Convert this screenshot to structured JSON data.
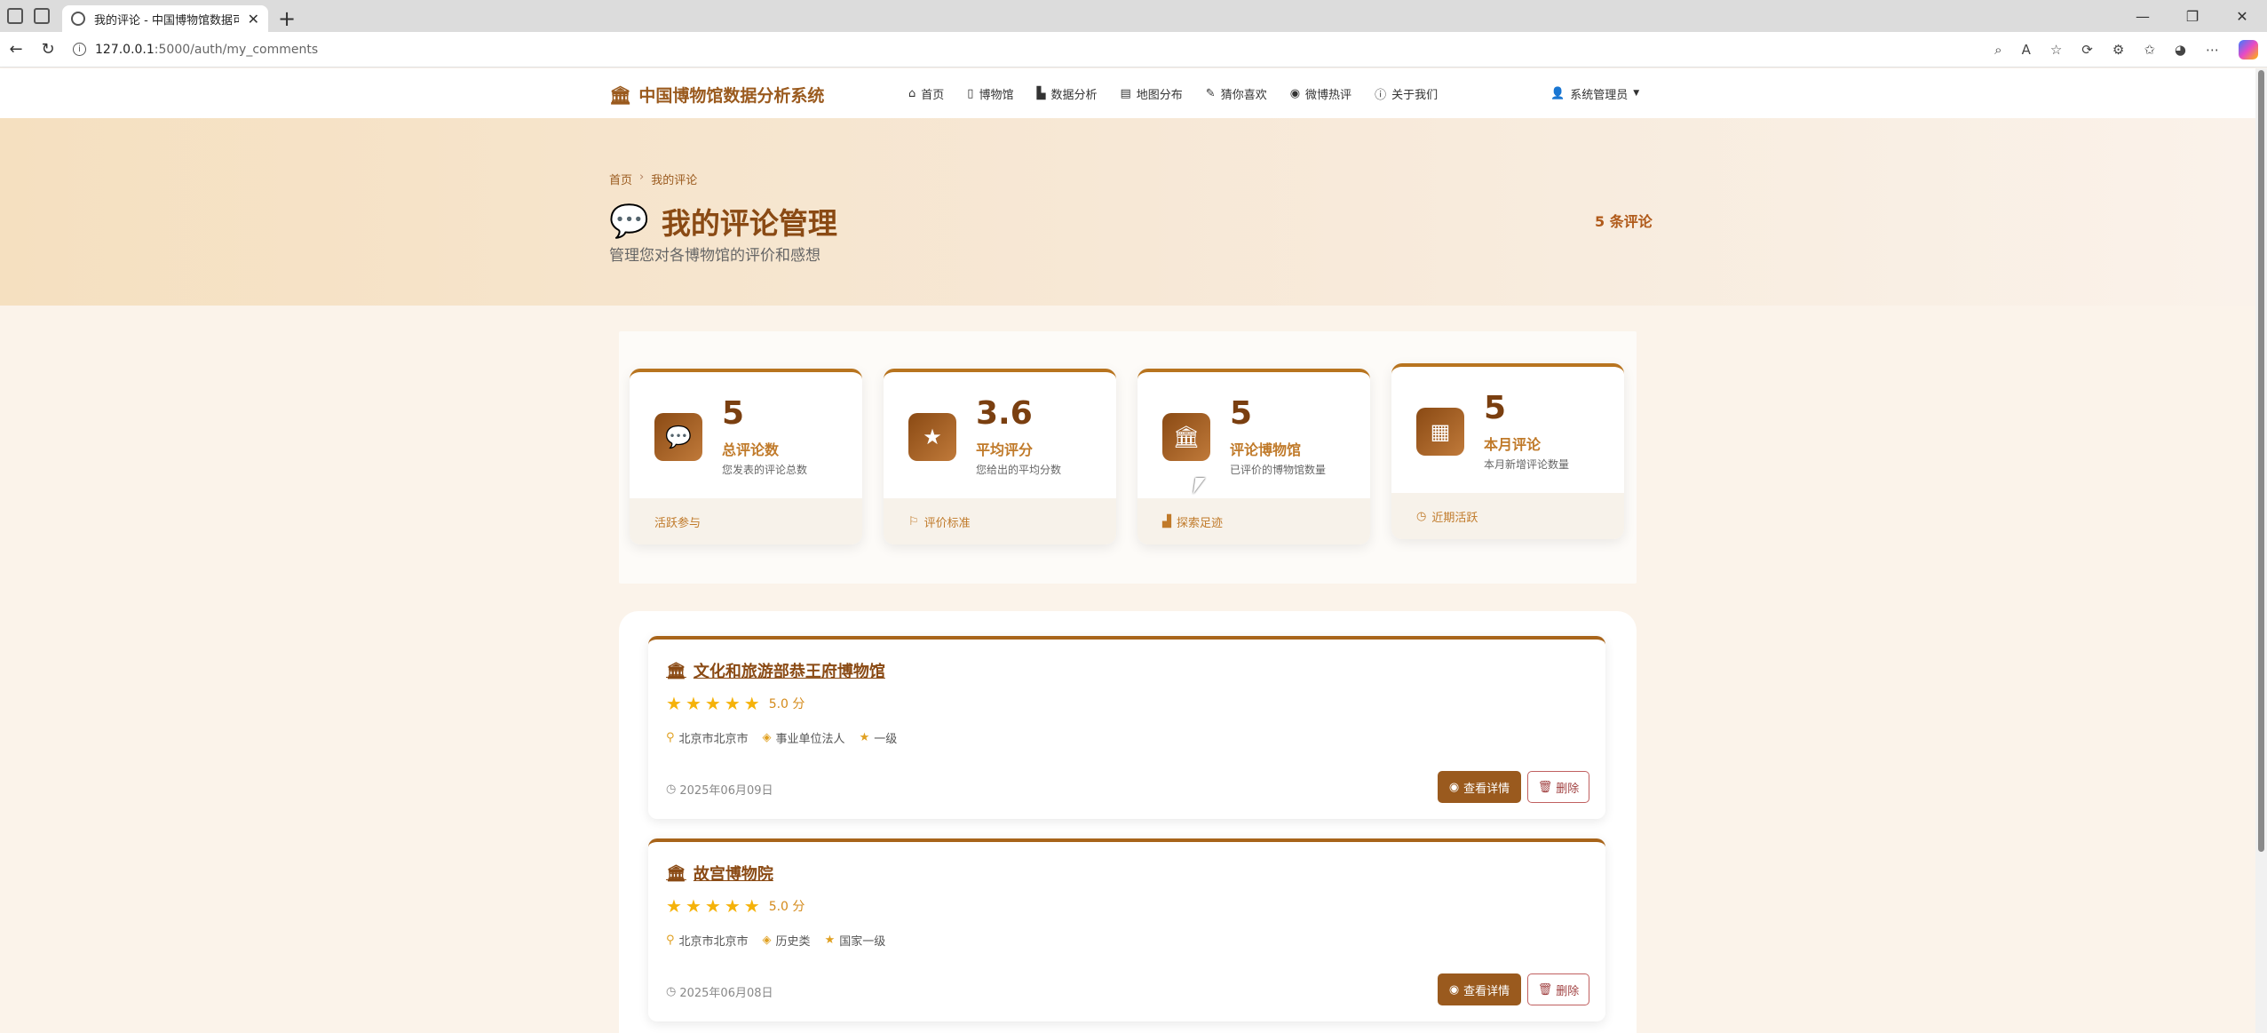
{
  "browser": {
    "tab_title": "我的评论 - 中国博物馆数据可视化",
    "tab_close": "✕",
    "new_tab": "+",
    "url_host": "127.0.0.1",
    "url_path": ":5000/auth/my_comments",
    "window_controls": [
      "—",
      "❐",
      "✕"
    ]
  },
  "navbar": {
    "brand": "中国博物馆数据分析系统",
    "menu": [
      {
        "icon": "home-icon",
        "glyph": "⌂",
        "label": "首页"
      },
      {
        "icon": "building-icon",
        "glyph": "▯",
        "label": "博物馆"
      },
      {
        "icon": "chart-icon",
        "glyph": "▙",
        "label": "数据分析"
      },
      {
        "icon": "map-icon",
        "glyph": "▤",
        "label": "地图分布"
      },
      {
        "icon": "pencil-icon",
        "glyph": "✎",
        "label": "猜你喜欢"
      },
      {
        "icon": "weibo-icon",
        "glyph": "◉",
        "label": "微博热评"
      },
      {
        "icon": "info-icon",
        "glyph": "ⓘ",
        "label": "关于我们"
      }
    ],
    "user": "系统管理员"
  },
  "hero": {
    "breadcrumb": [
      "首页",
      "我的评论"
    ],
    "title": "我的评论管理",
    "subtitle": "管理您对各博物馆的评价和感想",
    "count": "5 条评论"
  },
  "stats": [
    {
      "icon": "comments-icon",
      "glyph": "💬",
      "value": "5",
      "label": "总评论数",
      "desc": "您发表的评论总数",
      "footer": "活跃参与",
      "footer_icon": ""
    },
    {
      "icon": "star-icon",
      "glyph": "★",
      "value": "3.6",
      "label": "平均评分",
      "desc": "您给出的平均分数",
      "footer": "评价标准",
      "footer_icon": "⚐"
    },
    {
      "icon": "museum-icon",
      "glyph": "🏛",
      "value": "5",
      "label": "评论博物馆",
      "desc": "已评价的博物馆数量",
      "footer": "探索足迹",
      "footer_icon": "▟"
    },
    {
      "icon": "calendar-icon",
      "glyph": "▦",
      "value": "5",
      "label": "本月评论",
      "desc": "本月新增评论数量",
      "footer": "近期活跃",
      "footer_icon": "◷"
    }
  ],
  "comments": [
    {
      "museum": "文化和旅游部恭王府博物馆",
      "score": "5.0 分",
      "stars": 5,
      "location": "北京市北京市",
      "type": "事业单位法人",
      "level": "一级",
      "date": "2025年06月09日",
      "view_label": "查看详情",
      "delete_label": "删除"
    },
    {
      "museum": "故宫博物院",
      "score": "5.0 分",
      "stars": 5,
      "location": "北京市北京市",
      "type": "历史类",
      "level": "国家一级",
      "date": "2025年06月08日",
      "view_label": "查看详情",
      "delete_label": "删除"
    }
  ],
  "colors": {
    "brand": "#9a5a1e",
    "accent": "#c07a2a",
    "star": "#f5b20a"
  }
}
